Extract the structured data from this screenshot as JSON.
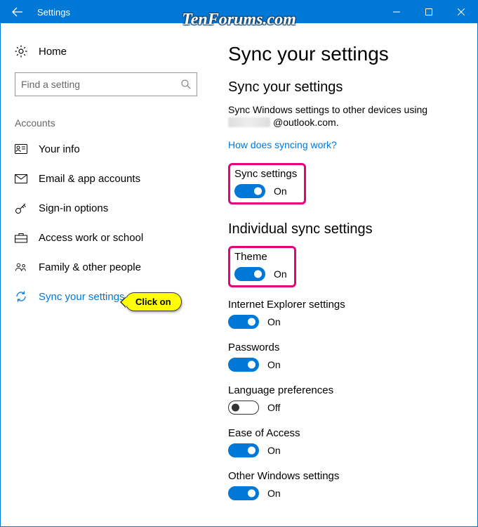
{
  "window": {
    "title": "Settings"
  },
  "watermark": "TenForums.com",
  "sidebar": {
    "home_label": "Home",
    "search_placeholder": "Find a setting",
    "section_label": "Accounts",
    "items": [
      {
        "label": "Your info",
        "icon": "user-card-icon"
      },
      {
        "label": "Email & app accounts",
        "icon": "mail-icon"
      },
      {
        "label": "Sign-in options",
        "icon": "key-icon"
      },
      {
        "label": "Access work or school",
        "icon": "briefcase-icon"
      },
      {
        "label": "Family & other people",
        "icon": "people-icon"
      },
      {
        "label": "Sync your settings",
        "icon": "sync-icon",
        "active": true
      }
    ]
  },
  "main": {
    "title": "Sync your settings",
    "subtitle": "Sync your settings",
    "description": "Sync Windows settings to other devices using",
    "email_suffix": "@outlook.com.",
    "help_link": "How does syncing work?",
    "sync_master": {
      "label": "Sync settings",
      "state": "On",
      "on": true
    },
    "individual_heading": "Individual sync settings",
    "settings": [
      {
        "label": "Theme",
        "state": "On",
        "on": true,
        "highlight": true
      },
      {
        "label": "Internet Explorer settings",
        "state": "On",
        "on": true
      },
      {
        "label": "Passwords",
        "state": "On",
        "on": true
      },
      {
        "label": "Language preferences",
        "state": "Off",
        "on": false
      },
      {
        "label": "Ease of Access",
        "state": "On",
        "on": true
      },
      {
        "label": "Other Windows settings",
        "state": "On",
        "on": true
      }
    ]
  },
  "callout": "Click on"
}
